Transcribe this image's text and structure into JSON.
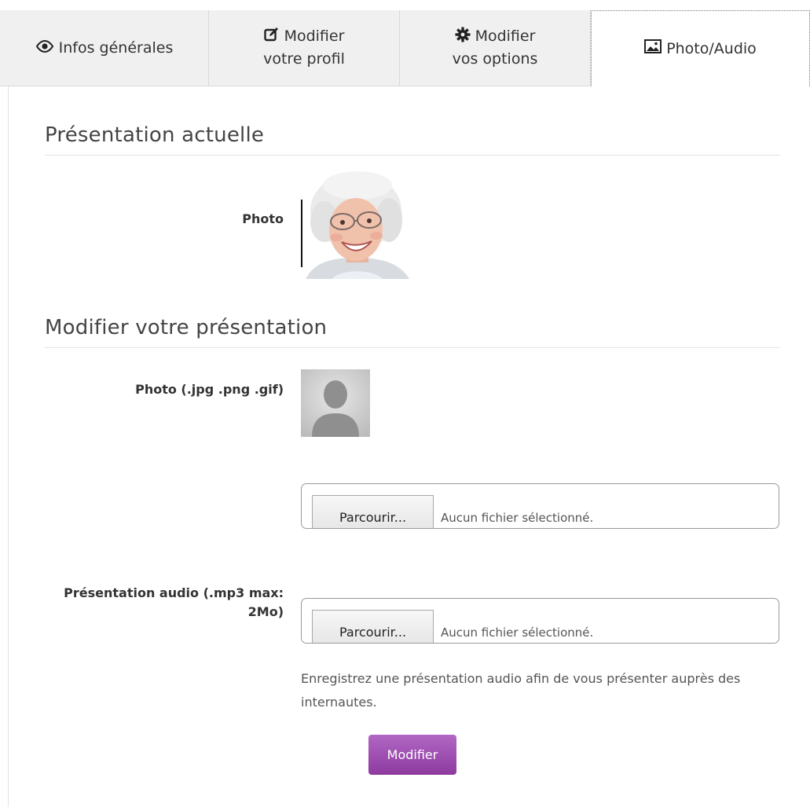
{
  "tabs": [
    {
      "label": "Infos générales",
      "icon": "eye-icon"
    },
    {
      "label_line1": "Modifier",
      "label_line2": "votre profil",
      "icon": "edit-icon"
    },
    {
      "label_line1": "Modifier",
      "label_line2": "vos options",
      "icon": "gear-icon"
    },
    {
      "label": "Photo/Audio",
      "icon": "image-icon",
      "active": true
    }
  ],
  "current": {
    "title": "Présentation actuelle",
    "photo_label": "Photo"
  },
  "edit": {
    "title": "Modifier votre présentation",
    "photo_label": "Photo (.jpg .png .gif)",
    "photo_file": {
      "button": "Parcourir...",
      "status": "Aucun fichier sélectionné."
    },
    "audio_label_line1": "Présentation audio (.mp3 max:",
    "audio_label_line2": "2Mo)",
    "audio_file": {
      "button": "Parcourir...",
      "status": "Aucun fichier sélectionné."
    },
    "help_text": "Enregistrez une présentation audio afin de vous présenter auprès des internautes.",
    "submit_label": "Modifier"
  },
  "colors": {
    "accent": "#9b4bad",
    "tab_bg": "#f0f0f0"
  }
}
